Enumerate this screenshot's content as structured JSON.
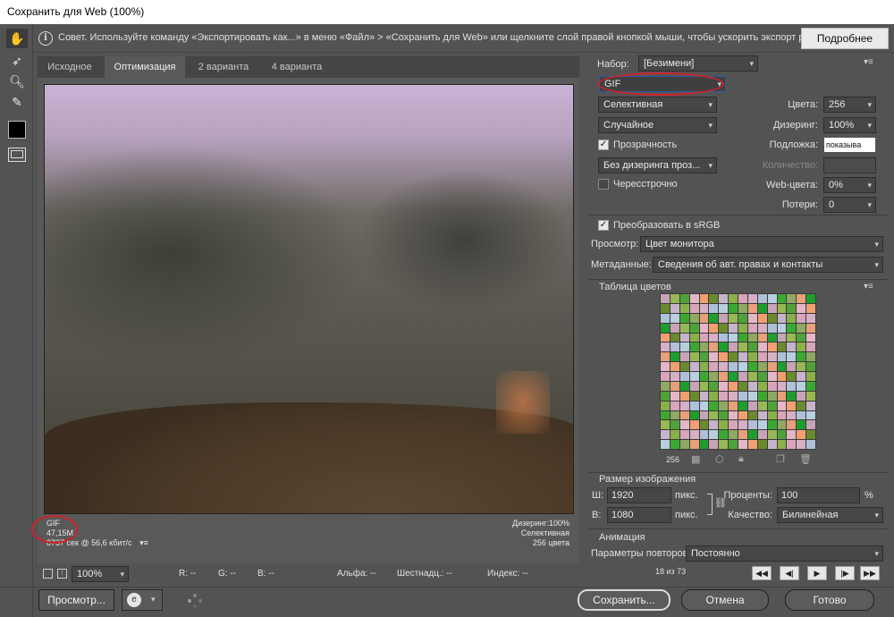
{
  "window": {
    "title": "Сохранить для Web (100%)"
  },
  "tip": {
    "icon": "info-icon",
    "text": "Совет. Используйте команду «Экспортировать как...» в меню «Файл» > «Сохранить для Web» или щелкните слой правой кнопкой мыши, чтобы ускорить экспорт ресурсов",
    "more_label": "Подробнее"
  },
  "tools": [
    "hand-icon",
    "slice-select-icon",
    "zoom-icon",
    "eyedropper-icon",
    "color-swatch-icon",
    "preview-toggle-icon"
  ],
  "tabs": [
    {
      "label": "Исходное",
      "active": false
    },
    {
      "label": "Оптимизация",
      "active": true
    },
    {
      "label": "2 варианта",
      "active": false
    },
    {
      "label": "4 варианта",
      "active": false
    }
  ],
  "image_info": {
    "format": "GIF",
    "size": "47,15M",
    "time": "8737 сек @ 56,6 кбит/с",
    "dither": "Дизеринг:100%",
    "palette": "Селективная",
    "colors": "256 цвета"
  },
  "statusbar": {
    "zoom": "100%",
    "r": "R: --",
    "g": "G: --",
    "b": "B: --",
    "alpha": "Альфа: --",
    "hex": "Шестнадц.: --",
    "index": "Индекс: --"
  },
  "footer": {
    "preview_label": "Просмотр...",
    "browser_icon": "browser-preview-icon",
    "save_label": "Сохранить...",
    "cancel_label": "Отмена",
    "done_label": "Готово"
  },
  "settings": {
    "preset_label": "Набор:",
    "preset_value": "[Безимени]",
    "format_value": "GIF",
    "reduction_value": "Селективная",
    "dither_algo_value": "Случайное",
    "transparency_label": "Прозрачность",
    "transparency_checked": true,
    "transparency_dither_value": "Без дизеринга проз...",
    "interlaced_label": "Чересстрочно",
    "interlaced_checked": false,
    "colors_label": "Цвета:",
    "colors_value": "256",
    "dither_label": "Дизеринг:",
    "dither_value": "100%",
    "matte_label": "Подложка:",
    "matte_value": "показыва",
    "amount_label": "Количество:",
    "websnap_label": "Web-цвета:",
    "websnap_value": "0%",
    "lossy_label": "Потери:",
    "lossy_value": "0",
    "srgb_label": "Преобразовать в sRGB",
    "srgb_checked": true,
    "preview_label": "Просмотр:",
    "preview_value": "Цвет монитора",
    "metadata_label": "Метаданные:",
    "metadata_value": "Сведения об авт. правах и контакты"
  },
  "color_table": {
    "title": "Таблица цветов",
    "count": "256",
    "palette": [
      "#c9a3b8",
      "#8ab04a",
      "#e7a07a",
      "#6a8a2e",
      "#3ca832",
      "#e4b6c8",
      "#b0c0d8",
      "#97b855",
      "#d8a5ba",
      "#1e9e2e",
      "#c7b4cc",
      "#8fa862",
      "#f0a070",
      "#b8cfe0",
      "#4fa23a",
      "#d6b0c4"
    ]
  },
  "image_size": {
    "title": "Размер изображения",
    "w_label": "Ш:",
    "w_value": "1920",
    "h_label": "В:",
    "h_value": "1080",
    "unit": "пикс.",
    "percent_label": "Проценты:",
    "percent_value": "100",
    "percent_unit": "%",
    "quality_label": "Качество:",
    "quality_value": "Билинейная"
  },
  "animation": {
    "title": "Анимация",
    "loop_label": "Параметры повторов:",
    "loop_value": "Постоянно",
    "frame_counter": "18 из 73"
  },
  "accent": {
    "highlight": "#d0222a",
    "active_field": "#2d5da8"
  }
}
